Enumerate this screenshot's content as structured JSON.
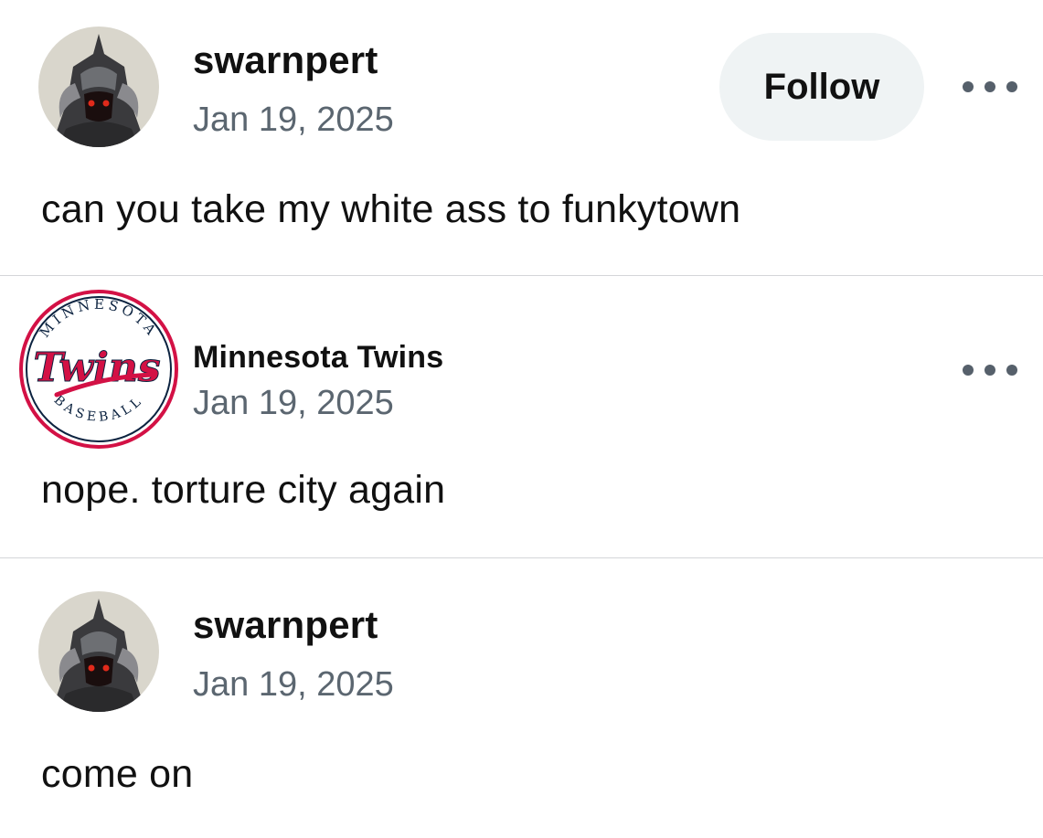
{
  "posts": [
    {
      "username": "swarnpert",
      "timestamp": "Jan 19, 2025",
      "text": "can you take my white ass to funkytown",
      "follow_label": "Follow"
    },
    {
      "username": "Minnesota Twins",
      "timestamp": "Jan 19, 2025",
      "text": "nope. torture city again",
      "logo": {
        "top_text": "MINNESOTA",
        "main_text": "Twins",
        "bottom_text": "BASEBALL"
      }
    },
    {
      "username": "swarnpert",
      "timestamp": "Jan 19, 2025",
      "text": "come on"
    }
  ],
  "colors": {
    "twins_red": "#d31145",
    "twins_navy": "#0c2340",
    "timestamp_gray": "#5b6670",
    "follow_bg": "#eff3f4",
    "divider": "#d4d6d9"
  }
}
